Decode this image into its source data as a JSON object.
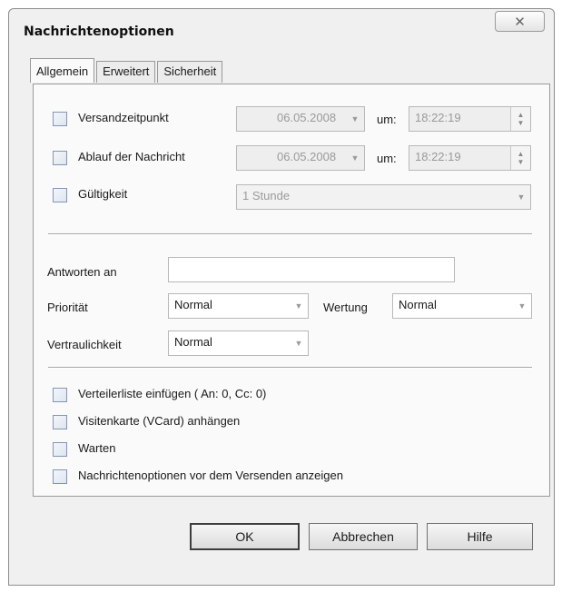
{
  "window": {
    "title": "Nachrichtenoptionen",
    "close_glyph": "✕"
  },
  "tabs": [
    {
      "label": "Allgemein",
      "active": true
    },
    {
      "label": "Erweitert",
      "active": false
    },
    {
      "label": "Sicherheit",
      "active": false
    }
  ],
  "schedule": {
    "versand": {
      "label": "Versandzeitpunkt",
      "checked": false,
      "date": "06.05.2008",
      "at_label": "um:",
      "time": "18:22:19"
    },
    "ablauf": {
      "label": "Ablauf der Nachricht",
      "checked": false,
      "date": "06.05.2008",
      "at_label": "um:",
      "time": "18:22:19"
    },
    "gueltigkeit": {
      "label": "Gültigkeit",
      "checked": false,
      "value": "1 Stunde"
    }
  },
  "props": {
    "antworten": {
      "label": "Antworten an",
      "value": ""
    },
    "prioritaet": {
      "label": "Priorität",
      "value": "Normal"
    },
    "wertung": {
      "label": "Wertung",
      "value": "Normal"
    },
    "vertraulichkeit": {
      "label": "Vertraulichkeit",
      "value": "Normal"
    }
  },
  "options": [
    {
      "label": "Verteilerliste einfügen ( An: 0, Cc: 0)",
      "checked": false
    },
    {
      "label": "Visitenkarte (VCard) anhängen",
      "checked": false
    },
    {
      "label": "Warten",
      "checked": false
    },
    {
      "label": "Nachrichtenoptionen vor dem Versenden anzeigen",
      "checked": false
    }
  ],
  "buttons": {
    "ok": "OK",
    "cancel": "Abbrechen",
    "help": "Hilfe"
  }
}
